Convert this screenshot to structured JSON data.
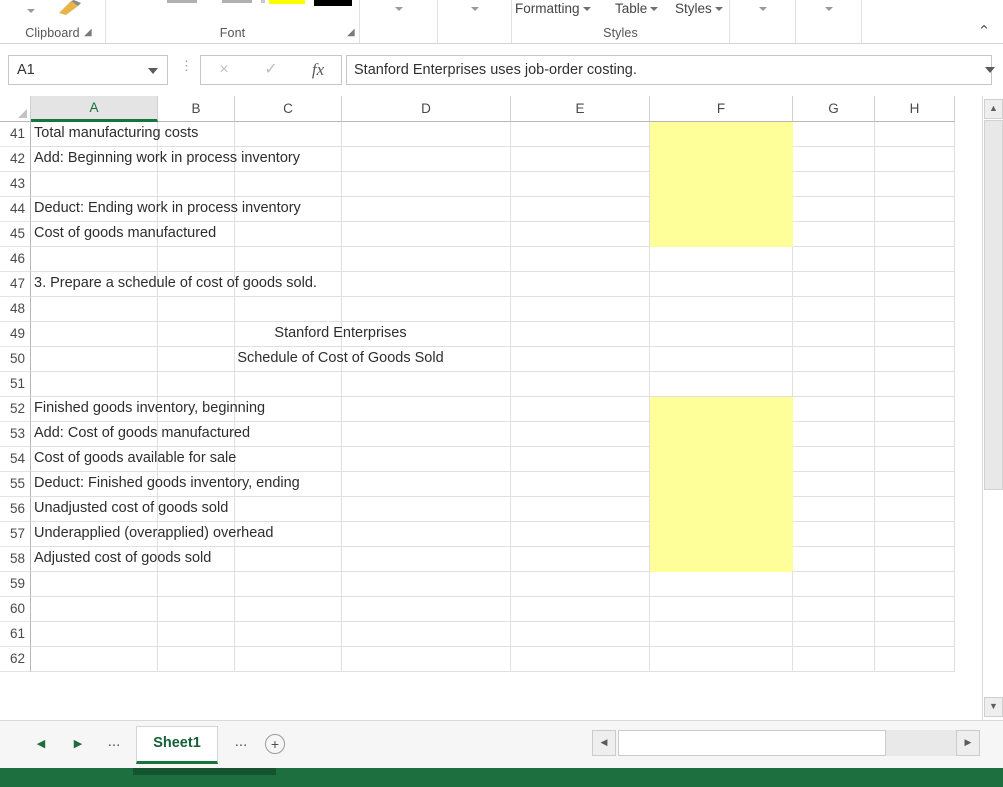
{
  "app": {
    "name": "Excel Spreadsheet"
  },
  "ribbon": {
    "groups": [
      {
        "label": "Clipboard"
      },
      {
        "label": "Font"
      },
      {
        "label": "Styles"
      }
    ],
    "style_buttons": [
      {
        "label": "Formatting"
      },
      {
        "label": "Table"
      },
      {
        "label": "Styles"
      }
    ],
    "collapse_icon": "chevron-up-icon",
    "collapse_glyph": "⌃"
  },
  "formula_bar": {
    "name_box_value": "A1",
    "cancel_glyph": "×",
    "confirm_glyph": "✓",
    "fx_label": "fx",
    "value": "Stanford Enterprises uses job-order costing.",
    "more_dots": "⋮"
  },
  "grid": {
    "columns": [
      {
        "label": "A",
        "selected": true
      },
      {
        "label": "B",
        "selected": false
      },
      {
        "label": "C",
        "selected": false
      },
      {
        "label": "D",
        "selected": false
      },
      {
        "label": "E",
        "selected": false
      },
      {
        "label": "F",
        "selected": false
      },
      {
        "label": "G",
        "selected": false
      },
      {
        "label": "H",
        "selected": false
      }
    ],
    "rows": [
      {
        "number": "41",
        "text": "Total manufacturing costs",
        "align": "left",
        "span": "A",
        "highlight_f": true
      },
      {
        "number": "42",
        "text": "Add: Beginning work in process inventory",
        "align": "left",
        "span": "A",
        "highlight_f": true
      },
      {
        "number": "43",
        "text": "",
        "align": "left",
        "span": "A",
        "highlight_f": true
      },
      {
        "number": "44",
        "text": "Deduct: Ending work in process inventory",
        "align": "left",
        "span": "A",
        "highlight_f": true
      },
      {
        "number": "45",
        "text": "Cost of goods manufactured",
        "align": "left",
        "span": "A",
        "highlight_f": true
      },
      {
        "number": "46",
        "text": "",
        "align": "left",
        "span": "A",
        "highlight_f": false
      },
      {
        "number": "47",
        "text": "3. Prepare a schedule of cost of goods sold.",
        "align": "left",
        "span": "A",
        "highlight_f": false
      },
      {
        "number": "48",
        "text": "",
        "align": "left",
        "span": "A",
        "highlight_f": false
      },
      {
        "number": "49",
        "text": "Stanford Enterprises",
        "align": "center",
        "span": "AE",
        "highlight_f": false
      },
      {
        "number": "50",
        "text": "Schedule of Cost of Goods Sold",
        "align": "center",
        "span": "AE",
        "highlight_f": false
      },
      {
        "number": "51",
        "text": "",
        "align": "left",
        "span": "A",
        "highlight_f": false
      },
      {
        "number": "52",
        "text": "Finished goods inventory, beginning",
        "align": "left",
        "span": "A",
        "highlight_f": true
      },
      {
        "number": "53",
        "text": "Add: Cost of goods manufactured",
        "align": "left",
        "span": "A",
        "highlight_f": true
      },
      {
        "number": "54",
        "text": "Cost of goods available for sale",
        "align": "left",
        "span": "A",
        "highlight_f": true
      },
      {
        "number": "55",
        "text": "Deduct: Finished goods inventory, ending",
        "align": "left",
        "span": "A",
        "highlight_f": true
      },
      {
        "number": "56",
        "text": "Unadjusted cost of goods sold",
        "align": "left",
        "span": "A",
        "highlight_f": true
      },
      {
        "number": "57",
        "text": "Underapplied (overapplied) overhead",
        "align": "left",
        "span": "A",
        "highlight_f": true
      },
      {
        "number": "58",
        "text": "Adjusted cost of goods sold",
        "align": "left",
        "span": "A",
        "highlight_f": true
      },
      {
        "number": "59",
        "text": "",
        "align": "left",
        "span": "A",
        "highlight_f": false
      },
      {
        "number": "60",
        "text": "",
        "align": "left",
        "span": "A",
        "highlight_f": false
      },
      {
        "number": "61",
        "text": "",
        "align": "left",
        "span": "A",
        "highlight_f": false
      },
      {
        "number": "62",
        "text": "",
        "align": "left",
        "span": "A",
        "highlight_f": false
      }
    ],
    "highlight_color": "#ffff99",
    "selection_color": "#16743d"
  },
  "sheet_bar": {
    "first_glyph": "◀",
    "next_glyph": "▶",
    "left_dots": "...",
    "right_dots": "...",
    "tabs": [
      {
        "label": "Sheet1",
        "active": true
      }
    ],
    "add_sheet_glyph": "+"
  },
  "scrollbars": {
    "v_up_glyph": "▲",
    "v_down_glyph": "▼",
    "h_left_glyph": "◀",
    "h_right_glyph": "▶"
  }
}
